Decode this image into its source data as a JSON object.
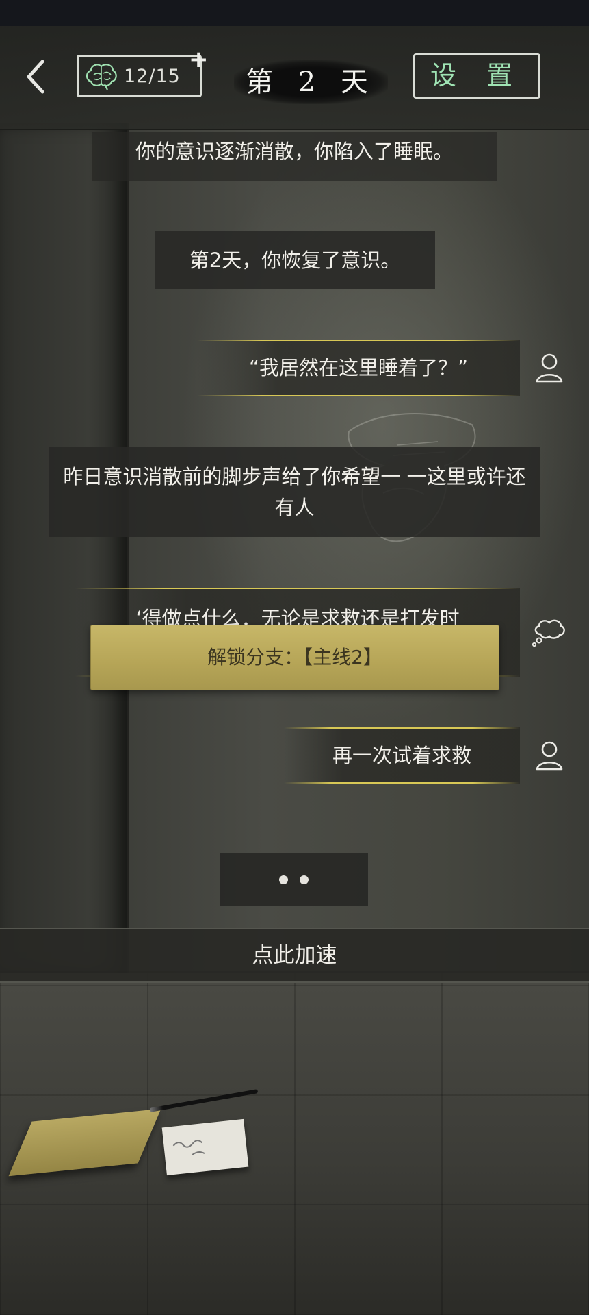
{
  "topbar": {
    "brain_count": "12/15",
    "plus": "+",
    "day_title": "第 2 天",
    "settings_label": "设 置"
  },
  "messages": {
    "narration_1": "你的意识逐渐消散，你陷入了睡眠。",
    "narration_2": "第2天，你恢复了意识。",
    "speech_1": "“我居然在这里睡着了？”",
    "narration_3": "昨日意识消散前的脚步声给了你希望一 一这里或许还有人",
    "thought_1": "‘得做点什么．无论是求救还是打发时",
    "unlock_banner": "解锁分支：【主线2】",
    "speech_2": "再一次试着求救"
  },
  "speed_up_label": "点此加速",
  "icons": {
    "back": "chevron-left-icon",
    "brain": "brain-icon",
    "person": "person-icon",
    "thought": "thought-bubble-icon"
  },
  "colors": {
    "settings_text": "#9fe3b3",
    "brain_stroke": "#9fe0b0",
    "speech_line": "#d8c856",
    "unlock_banner": "#b7a658"
  }
}
